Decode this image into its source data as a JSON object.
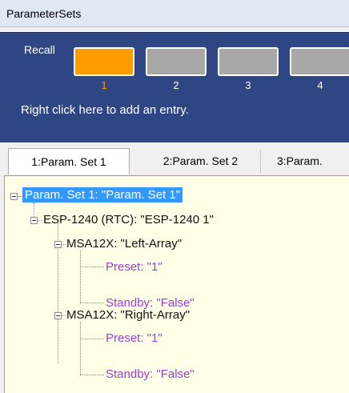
{
  "window": {
    "title": "ParameterSets"
  },
  "recall": {
    "label": "Recall",
    "slots": [
      {
        "number": "1",
        "active": true
      },
      {
        "number": "2",
        "active": false
      },
      {
        "number": "3",
        "active": false
      },
      {
        "number": "4",
        "active": false
      }
    ],
    "hint": "Right click here to add an entry."
  },
  "tabs": [
    {
      "label": "1:Param. Set 1",
      "selected": true
    },
    {
      "label": "2:Param. Set 2",
      "selected": false
    },
    {
      "label": "3:Param.",
      "selected": false
    }
  ],
  "tree": {
    "root": "Param. Set 1: \"Param. Set 1\"",
    "device": "ESP-1240 (RTC): \"ESP-1240 1\"",
    "arrays": [
      {
        "name": "MSA12X: \"Left-Array\"",
        "preset": "Preset: \"1\"",
        "standby": "Standby: \"False\""
      },
      {
        "name": "MSA12X: \"Right-Array\"",
        "preset": "Preset: \"1\"",
        "standby": "Standby: \"False\""
      }
    ]
  },
  "colors": {
    "accent": "#ff9d00",
    "panel": "#2f4684",
    "selection": "#3399ff",
    "leaf_text": "#9a3ed6",
    "tree_bg": "#ffffe8"
  }
}
